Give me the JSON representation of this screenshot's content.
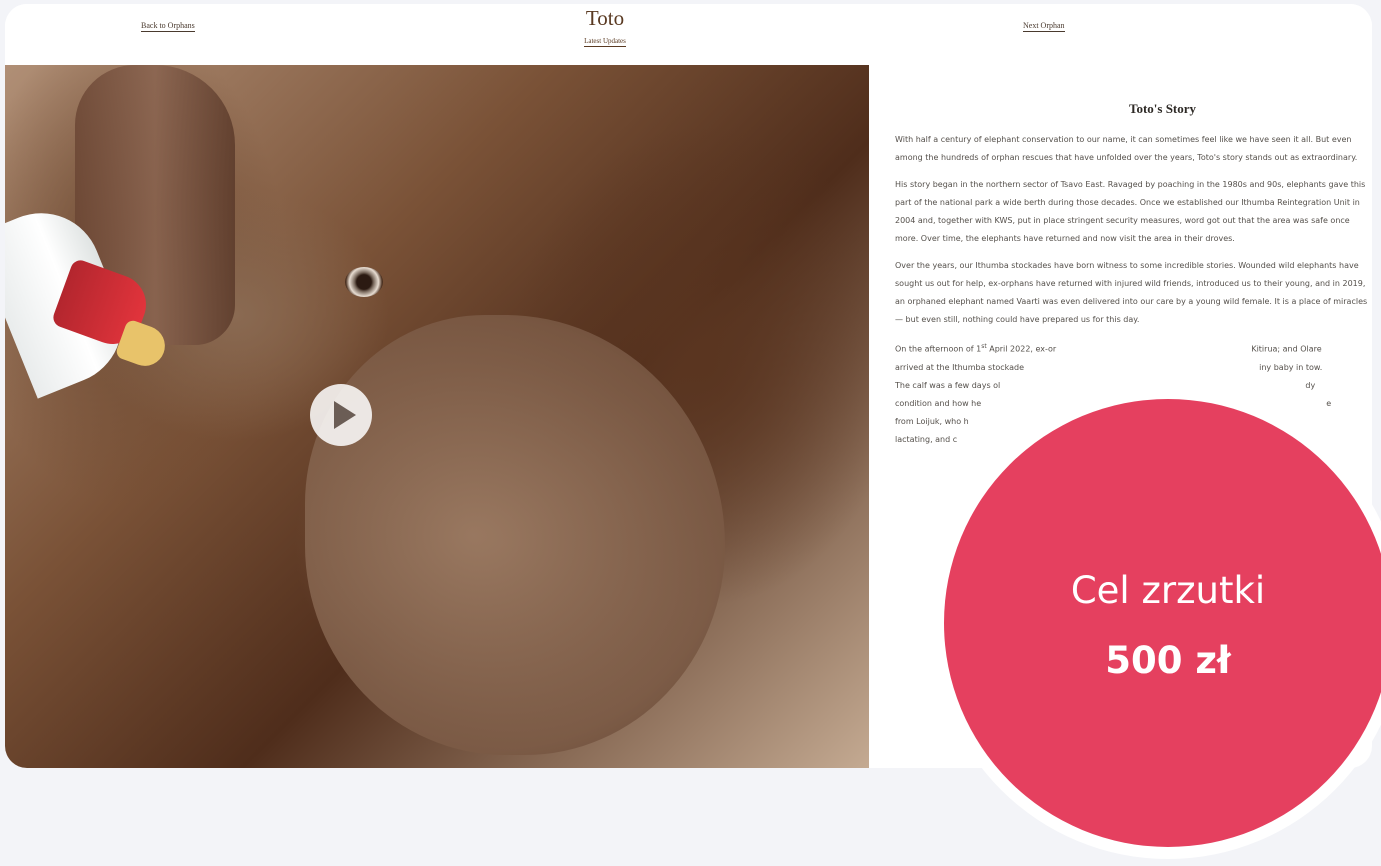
{
  "header": {
    "back_label": "Back to Orphans",
    "title": "Toto",
    "updates_label": "Latest Updates",
    "next_label": "Next Orphan"
  },
  "media": {
    "play_icon": "play-icon",
    "image_subject": "elephant-calf-bottle-feeding"
  },
  "story": {
    "heading": "Toto's Story",
    "paragraphs": [
      "With half a century of elephant conservation to our name, it can sometimes feel like we have seen it all. But even among the hundreds of orphan rescues that have unfolded over the years, Toto's story stands out as extraordinary.",
      "His story began in the northern sector of Tsavo East. Ravaged by poaching in the 1980s and 90s, elephants gave this part of the national park a wide berth during those decades. Once we established our Ithumba Reintegration Unit in 2004 and, together with KWS, put in place stringent security measures, word got out that the area was safe once more. Over time, the elephants have returned and now visit the area in their droves.",
      "Over the years, our Ithumba stockades have born witness to some incredible stories. Wounded wild elephants have sought us out for help, ex-orphans have returned with injured wild friends, introduced us to their young, and in 2019, an orphaned elephant named Vaarti was even delivered into our care by a young wild female. It is a place of miracles — but even still, nothing could have prepared us for this day."
    ],
    "p4_lines": [
      "On the afternoon of 1",
      "st",
      " April 2022, ex-or",
      "Kitirua; and Olare",
      "arrived at the Ithumba stockade",
      "iny baby in tow.",
      "The calf was a few days ol",
      "dy",
      "condition and how he",
      "e",
      "from Loijuk, who h",
      "lactating, and c"
    ]
  },
  "badge": {
    "label": "Cel zrzutki",
    "amount": "500 zł",
    "color": "#e5405f"
  }
}
